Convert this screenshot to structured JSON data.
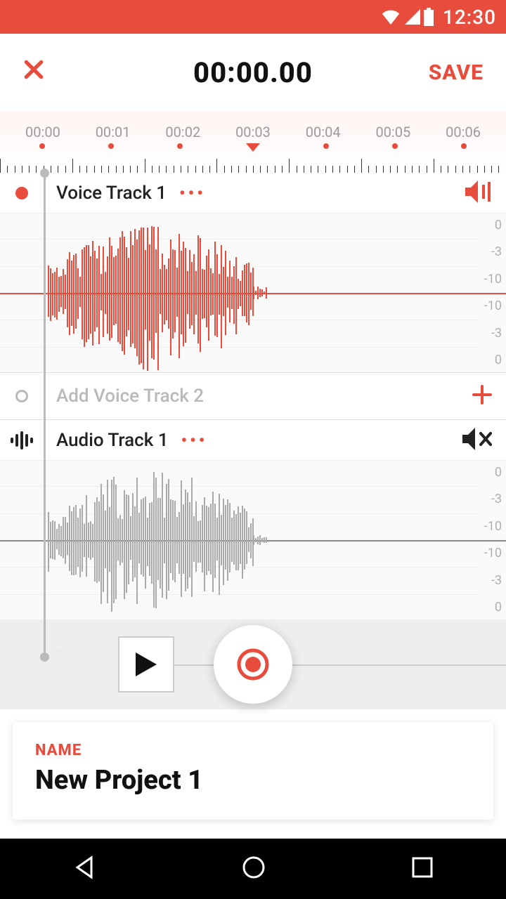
{
  "status": {
    "time": "12:30"
  },
  "header": {
    "timer": "00:00.00",
    "save": "SAVE"
  },
  "ruler": {
    "labels": [
      "00:00",
      "00:01",
      "00:02",
      "00:03",
      "00:04",
      "00:05",
      "00:06"
    ]
  },
  "tracks": {
    "voice1": {
      "label": "Voice Track 1",
      "menu": "•••"
    },
    "add": {
      "label": "Add Voice Track 2"
    },
    "audio1": {
      "label": "Audio Track 1",
      "menu": "•••"
    }
  },
  "db_scale": [
    "0",
    "-3",
    "-10",
    "-10",
    "-3",
    "0"
  ],
  "project": {
    "field_label": "NAME",
    "name": "New Project 1"
  },
  "colors": {
    "accent": "#e84c3d"
  }
}
